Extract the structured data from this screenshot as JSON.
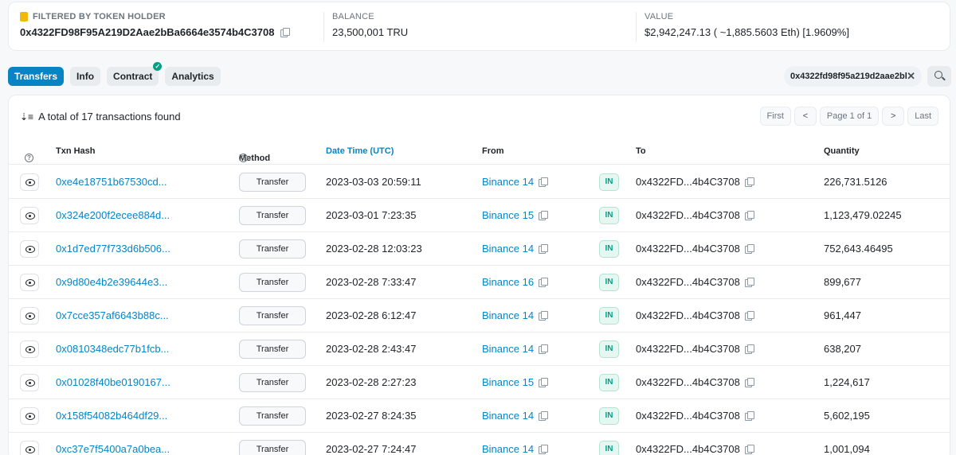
{
  "summary": {
    "filter_label": "FILTERED BY TOKEN HOLDER",
    "holder_address": "0x4322FD98F95A219D2Aae2bBa6664e3574b4C3708",
    "balance_label": "BALANCE",
    "balance_value": "23,500,001 TRU",
    "value_label": "VALUE",
    "value_value": "$2,942,247.13 ( ~1,885.5603 Eth) [1.9609%]"
  },
  "tabs": [
    "Transfers",
    "Info",
    "Contract",
    "Analytics"
  ],
  "filter_chip": "0x4322fd98f95a219d2aae2bl",
  "total_text": "A total of 17 transactions found",
  "pager": {
    "first": "First",
    "prev": "<",
    "page": "Page 1 of 1",
    "next": ">",
    "last": "Last"
  },
  "columns": {
    "hash": "Txn Hash",
    "method": "Method",
    "date": "Date Time (UTC)",
    "from": "From",
    "to": "To",
    "qty": "Quantity"
  },
  "rows": [
    {
      "hash": "0xe4e18751b67530cd...",
      "method": "Transfer",
      "date": "2023-03-03 20:59:11",
      "from": "Binance 14",
      "dir": "IN",
      "to": "0x4322FD...4b4C3708",
      "qty": "226,731.5126"
    },
    {
      "hash": "0x324e200f2ecee884d...",
      "method": "Transfer",
      "date": "2023-03-01 7:23:35",
      "from": "Binance 15",
      "dir": "IN",
      "to": "0x4322FD...4b4C3708",
      "qty": "1,123,479.02245"
    },
    {
      "hash": "0x1d7ed77f733d6b506...",
      "method": "Transfer",
      "date": "2023-02-28 12:03:23",
      "from": "Binance 14",
      "dir": "IN",
      "to": "0x4322FD...4b4C3708",
      "qty": "752,643.46495"
    },
    {
      "hash": "0x9d80e4b2e39644e3...",
      "method": "Transfer",
      "date": "2023-02-28 7:33:47",
      "from": "Binance 16",
      "dir": "IN",
      "to": "0x4322FD...4b4C3708",
      "qty": "899,677"
    },
    {
      "hash": "0x7cce357af6643b88c...",
      "method": "Transfer",
      "date": "2023-02-28 6:12:47",
      "from": "Binance 14",
      "dir": "IN",
      "to": "0x4322FD...4b4C3708",
      "qty": "961,447"
    },
    {
      "hash": "0x0810348edc77b1fcb...",
      "method": "Transfer",
      "date": "2023-02-28 2:43:47",
      "from": "Binance 14",
      "dir": "IN",
      "to": "0x4322FD...4b4C3708",
      "qty": "638,207"
    },
    {
      "hash": "0x01028f40be0190167...",
      "method": "Transfer",
      "date": "2023-02-28 2:27:23",
      "from": "Binance 15",
      "dir": "IN",
      "to": "0x4322FD...4b4C3708",
      "qty": "1,224,617"
    },
    {
      "hash": "0x158f54082b464df29...",
      "method": "Transfer",
      "date": "2023-02-27 8:24:35",
      "from": "Binance 14",
      "dir": "IN",
      "to": "0x4322FD...4b4C3708",
      "qty": "5,602,195"
    },
    {
      "hash": "0xc37e7f5400a7a0bea...",
      "method": "Transfer",
      "date": "2023-02-27 7:24:47",
      "from": "Binance 14",
      "dir": "IN",
      "to": "0x4322FD...4b4C3708",
      "qty": "1,001,094"
    }
  ]
}
